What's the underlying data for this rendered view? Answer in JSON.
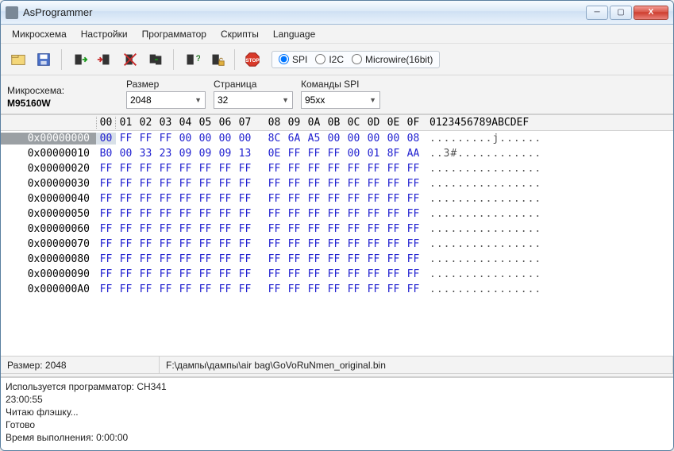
{
  "window": {
    "title": "AsProgrammer"
  },
  "menu": [
    "Микросхема",
    "Настройки",
    "Программатор",
    "Скрипты",
    "Language"
  ],
  "toolbar_icons": [
    "open-icon",
    "save-icon",
    "read-chip-icon",
    "write-chip-icon",
    "erase-chip-icon",
    "verify-chip-icon",
    "blank-check-icon",
    "chip-info-icon",
    "lock-icon",
    "stop-icon"
  ],
  "protocols": {
    "options": [
      "SPI",
      "I2C",
      "Microwire(16bit)"
    ],
    "selected": "SPI"
  },
  "params": {
    "chip_label": "Микросхема:",
    "chip_value": "M95160W",
    "size_label": "Размер",
    "size_value": "2048",
    "page_label": "Страница",
    "page_value": "32",
    "cmd_label": "Команды SPI",
    "cmd_value": "95xx"
  },
  "hex": {
    "header_left": [
      "00",
      "01",
      "02",
      "03",
      "04",
      "05",
      "06",
      "07"
    ],
    "header_right": [
      "08",
      "09",
      "0A",
      "0B",
      "0C",
      "0D",
      "0E",
      "0F"
    ],
    "ascii_header": "0123456789ABCDEF",
    "selected_row": 0,
    "rows": [
      {
        "addr": "0x00000000",
        "l": [
          "00",
          "FF",
          "FF",
          "FF",
          "00",
          "00",
          "00",
          "00"
        ],
        "r": [
          "8C",
          "6A",
          "A5",
          "00",
          "00",
          "00",
          "00",
          "08"
        ],
        "a": ".........j......"
      },
      {
        "addr": "0x00000010",
        "l": [
          "B0",
          "00",
          "33",
          "23",
          "09",
          "09",
          "09",
          "13"
        ],
        "r": [
          "0E",
          "FF",
          "FF",
          "FF",
          "00",
          "01",
          "8F",
          "AA"
        ],
        "a": "..3#............"
      },
      {
        "addr": "0x00000020",
        "l": [
          "FF",
          "FF",
          "FF",
          "FF",
          "FF",
          "FF",
          "FF",
          "FF"
        ],
        "r": [
          "FF",
          "FF",
          "FF",
          "FF",
          "FF",
          "FF",
          "FF",
          "FF"
        ],
        "a": "................"
      },
      {
        "addr": "0x00000030",
        "l": [
          "FF",
          "FF",
          "FF",
          "FF",
          "FF",
          "FF",
          "FF",
          "FF"
        ],
        "r": [
          "FF",
          "FF",
          "FF",
          "FF",
          "FF",
          "FF",
          "FF",
          "FF"
        ],
        "a": "................"
      },
      {
        "addr": "0x00000040",
        "l": [
          "FF",
          "FF",
          "FF",
          "FF",
          "FF",
          "FF",
          "FF",
          "FF"
        ],
        "r": [
          "FF",
          "FF",
          "FF",
          "FF",
          "FF",
          "FF",
          "FF",
          "FF"
        ],
        "a": "................"
      },
      {
        "addr": "0x00000050",
        "l": [
          "FF",
          "FF",
          "FF",
          "FF",
          "FF",
          "FF",
          "FF",
          "FF"
        ],
        "r": [
          "FF",
          "FF",
          "FF",
          "FF",
          "FF",
          "FF",
          "FF",
          "FF"
        ],
        "a": "................"
      },
      {
        "addr": "0x00000060",
        "l": [
          "FF",
          "FF",
          "FF",
          "FF",
          "FF",
          "FF",
          "FF",
          "FF"
        ],
        "r": [
          "FF",
          "FF",
          "FF",
          "FF",
          "FF",
          "FF",
          "FF",
          "FF"
        ],
        "a": "................"
      },
      {
        "addr": "0x00000070",
        "l": [
          "FF",
          "FF",
          "FF",
          "FF",
          "FF",
          "FF",
          "FF",
          "FF"
        ],
        "r": [
          "FF",
          "FF",
          "FF",
          "FF",
          "FF",
          "FF",
          "FF",
          "FF"
        ],
        "a": "................"
      },
      {
        "addr": "0x00000080",
        "l": [
          "FF",
          "FF",
          "FF",
          "FF",
          "FF",
          "FF",
          "FF",
          "FF"
        ],
        "r": [
          "FF",
          "FF",
          "FF",
          "FF",
          "FF",
          "FF",
          "FF",
          "FF"
        ],
        "a": "................"
      },
      {
        "addr": "0x00000090",
        "l": [
          "FF",
          "FF",
          "FF",
          "FF",
          "FF",
          "FF",
          "FF",
          "FF"
        ],
        "r": [
          "FF",
          "FF",
          "FF",
          "FF",
          "FF",
          "FF",
          "FF",
          "FF"
        ],
        "a": "................"
      },
      {
        "addr": "0x000000A0",
        "l": [
          "FF",
          "FF",
          "FF",
          "FF",
          "FF",
          "FF",
          "FF",
          "FF"
        ],
        "r": [
          "FF",
          "FF",
          "FF",
          "FF",
          "FF",
          "FF",
          "FF",
          "FF"
        ],
        "a": "................"
      }
    ]
  },
  "status": {
    "size_label": "Размер: 2048",
    "file_path": "F:\\дампы\\дампы\\air bag\\GoVoRuNmen_original.bin"
  },
  "log": [
    "Используется программатор: CH341",
    "23:00:55",
    "Читаю флэшку...",
    "Готово",
    "Время выполнения: 0:00:00"
  ]
}
